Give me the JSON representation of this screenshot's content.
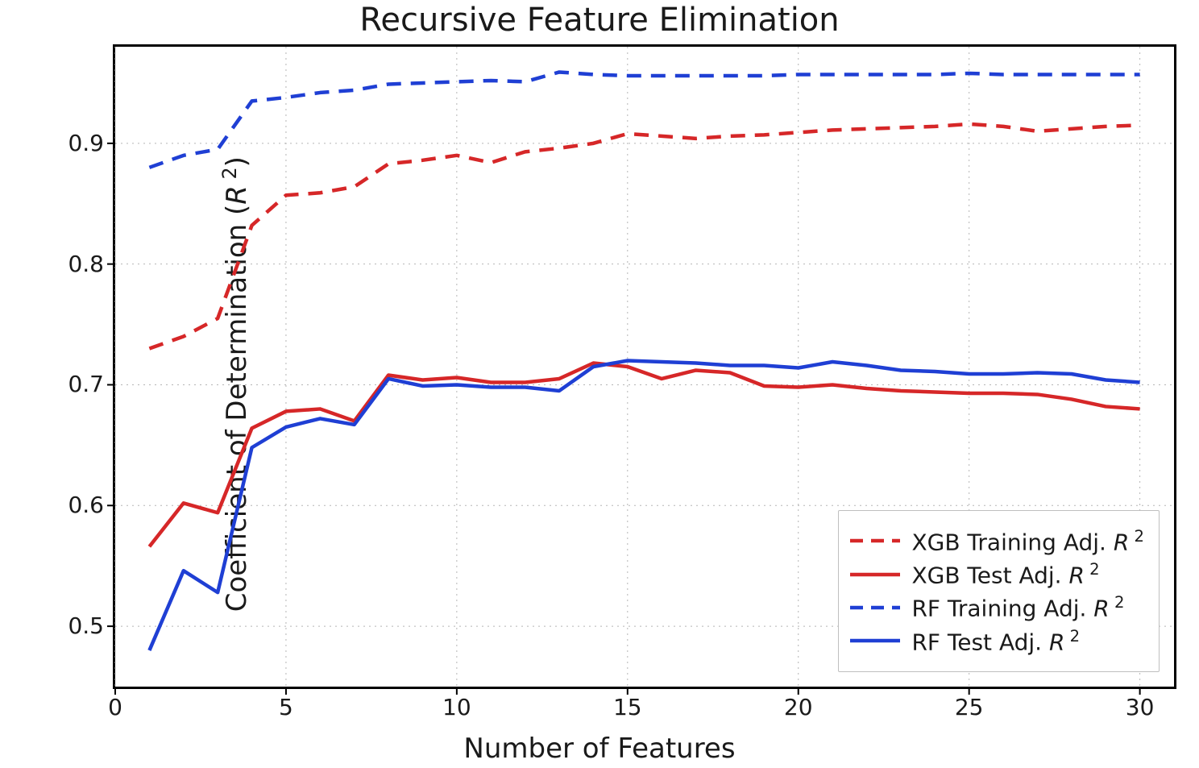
{
  "chart_data": {
    "type": "line",
    "title": "Recursive Feature Elimination",
    "xlabel": "Number of Features",
    "ylabel": "Coefficient of Determination (R²)",
    "xlim": [
      0,
      31
    ],
    "ylim": [
      0.45,
      0.98
    ],
    "xticks": [
      0,
      5,
      10,
      15,
      20,
      25,
      30
    ],
    "yticks": [
      0.5,
      0.6,
      0.7,
      0.8,
      0.9
    ],
    "x": [
      1,
      2,
      3,
      4,
      5,
      6,
      7,
      8,
      9,
      10,
      11,
      12,
      13,
      14,
      15,
      16,
      17,
      18,
      19,
      20,
      21,
      22,
      23,
      24,
      25,
      26,
      27,
      28,
      29,
      30
    ],
    "series": [
      {
        "name": "XGB Training Adj. R²",
        "color": "#d62728",
        "dash": true,
        "values": [
          0.73,
          0.74,
          0.755,
          0.832,
          0.857,
          0.859,
          0.864,
          0.883,
          0.886,
          0.89,
          0.884,
          0.893,
          0.896,
          0.9,
          0.908,
          0.906,
          0.904,
          0.906,
          0.907,
          0.909,
          0.911,
          0.912,
          0.913,
          0.914,
          0.916,
          0.914,
          0.91,
          0.912,
          0.914,
          0.915
        ],
        "legendLabelHTML": "XGB Training Adj. <i>R</i><sup>&nbsp;2</sup>"
      },
      {
        "name": "XGB Test Adj. R²",
        "color": "#d62728",
        "dash": false,
        "values": [
          0.566,
          0.602,
          0.594,
          0.664,
          0.678,
          0.68,
          0.67,
          0.708,
          0.704,
          0.706,
          0.702,
          0.702,
          0.705,
          0.718,
          0.715,
          0.705,
          0.712,
          0.71,
          0.699,
          0.698,
          0.7,
          0.697,
          0.695,
          0.694,
          0.693,
          0.693,
          0.692,
          0.688,
          0.682,
          0.68
        ],
        "legendLabelHTML": "XGB Test Adj. <i>R</i><sup>&nbsp;2</sup>"
      },
      {
        "name": "RF Training Adj. R²",
        "color": "#1f3fd4",
        "dash": true,
        "values": [
          0.88,
          0.89,
          0.895,
          0.935,
          0.938,
          0.942,
          0.944,
          0.949,
          0.95,
          0.951,
          0.952,
          0.951,
          0.959,
          0.957,
          0.956,
          0.956,
          0.956,
          0.956,
          0.956,
          0.957,
          0.957,
          0.957,
          0.957,
          0.957,
          0.958,
          0.957,
          0.957,
          0.957,
          0.957,
          0.957
        ],
        "legendLabelHTML": "RF Training Adj. <i>R</i><sup>&nbsp;2</sup>"
      },
      {
        "name": "RF Test Adj. R²",
        "color": "#1f3fd4",
        "dash": false,
        "values": [
          0.48,
          0.546,
          0.528,
          0.648,
          0.665,
          0.672,
          0.667,
          0.705,
          0.699,
          0.7,
          0.698,
          0.698,
          0.695,
          0.715,
          0.72,
          0.719,
          0.718,
          0.716,
          0.716,
          0.714,
          0.719,
          0.716,
          0.712,
          0.711,
          0.709,
          0.709,
          0.71,
          0.709,
          0.704,
          0.702
        ],
        "legendLabelHTML": "RF Test Adj. <i>R</i><sup>&nbsp;2</sup>"
      }
    ]
  }
}
